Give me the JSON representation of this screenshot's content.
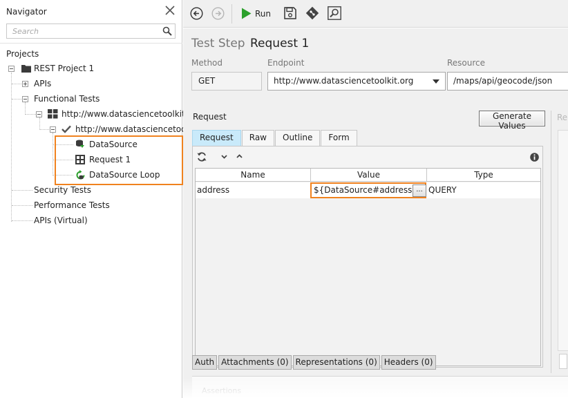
{
  "navigator": {
    "title": "Navigator",
    "search_placeholder": "Search",
    "projects_label": "Projects",
    "tree": {
      "project": "REST Project 1",
      "apis": "APIs",
      "functional_tests": "Functional Tests",
      "suite": "http://www.datasciencetoolkit.",
      "test_case": "http://www.datasciencetoo",
      "steps": [
        "DataSource",
        "Request 1",
        "DataSource Loop"
      ],
      "security_tests": "Security Tests",
      "performance_tests": "Performance Tests",
      "virtual_apis": "APIs (Virtual)"
    }
  },
  "toolbar": {
    "run_label": "Run"
  },
  "editor": {
    "step_type": "Test Step",
    "step_name": "Request 1",
    "method_label": "Method",
    "method_value": "GET",
    "endpoint_label": "Endpoint",
    "endpoint_value": "http://www.datasciencetoolkit.org",
    "resource_label": "Resource",
    "resource_value": "/maps/api/geocode/json",
    "request_section_label": "Request",
    "generate_button": "Generate Values",
    "right_panel_ghost": "Re",
    "tabs": [
      "Request",
      "Raw",
      "Outline",
      "Form"
    ],
    "active_tab": "Request",
    "params": {
      "headers": [
        "Name",
        "Value",
        "Type"
      ],
      "rows": [
        {
          "name": "address",
          "value": "${DataSource#address}",
          "type": "QUERY",
          "button": "..."
        }
      ]
    },
    "bottom_tabs": [
      "Auth",
      "Attachments (0)",
      "Representations (0)",
      "Headers (0)"
    ],
    "assertions_ghost": "Assertions"
  },
  "colors": {
    "highlight": "#f0821e",
    "active_tab": "#c9eafa",
    "run_green": "#2ca02c"
  }
}
